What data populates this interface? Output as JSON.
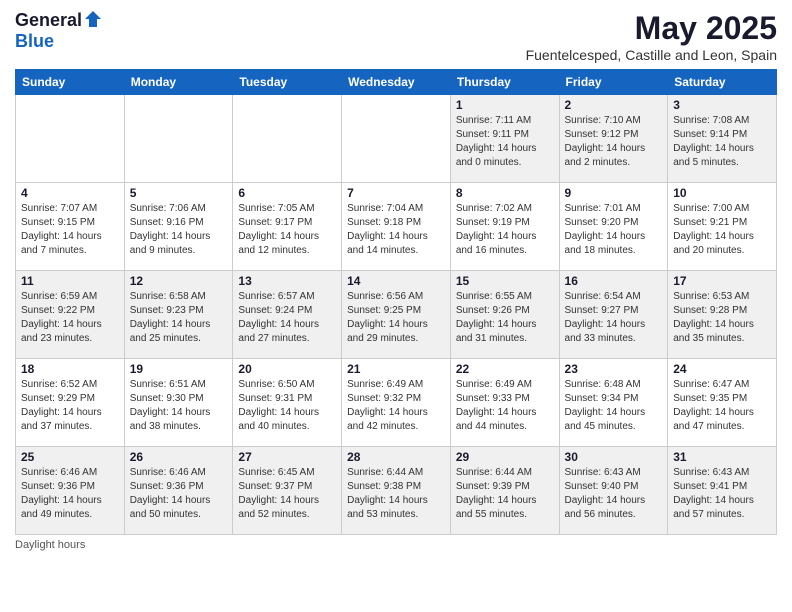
{
  "logo": {
    "general": "General",
    "blue": "Blue"
  },
  "title": "May 2025",
  "subtitle": "Fuentelcesped, Castille and Leon, Spain",
  "headers": [
    "Sunday",
    "Monday",
    "Tuesday",
    "Wednesday",
    "Thursday",
    "Friday",
    "Saturday"
  ],
  "weeks": [
    [
      {
        "day": "",
        "info": ""
      },
      {
        "day": "",
        "info": ""
      },
      {
        "day": "",
        "info": ""
      },
      {
        "day": "",
        "info": ""
      },
      {
        "day": "1",
        "info": "Sunrise: 7:11 AM\nSunset: 9:11 PM\nDaylight: 14 hours\nand 0 minutes."
      },
      {
        "day": "2",
        "info": "Sunrise: 7:10 AM\nSunset: 9:12 PM\nDaylight: 14 hours\nand 2 minutes."
      },
      {
        "day": "3",
        "info": "Sunrise: 7:08 AM\nSunset: 9:14 PM\nDaylight: 14 hours\nand 5 minutes."
      }
    ],
    [
      {
        "day": "4",
        "info": "Sunrise: 7:07 AM\nSunset: 9:15 PM\nDaylight: 14 hours\nand 7 minutes."
      },
      {
        "day": "5",
        "info": "Sunrise: 7:06 AM\nSunset: 9:16 PM\nDaylight: 14 hours\nand 9 minutes."
      },
      {
        "day": "6",
        "info": "Sunrise: 7:05 AM\nSunset: 9:17 PM\nDaylight: 14 hours\nand 12 minutes."
      },
      {
        "day": "7",
        "info": "Sunrise: 7:04 AM\nSunset: 9:18 PM\nDaylight: 14 hours\nand 14 minutes."
      },
      {
        "day": "8",
        "info": "Sunrise: 7:02 AM\nSunset: 9:19 PM\nDaylight: 14 hours\nand 16 minutes."
      },
      {
        "day": "9",
        "info": "Sunrise: 7:01 AM\nSunset: 9:20 PM\nDaylight: 14 hours\nand 18 minutes."
      },
      {
        "day": "10",
        "info": "Sunrise: 7:00 AM\nSunset: 9:21 PM\nDaylight: 14 hours\nand 20 minutes."
      }
    ],
    [
      {
        "day": "11",
        "info": "Sunrise: 6:59 AM\nSunset: 9:22 PM\nDaylight: 14 hours\nand 23 minutes."
      },
      {
        "day": "12",
        "info": "Sunrise: 6:58 AM\nSunset: 9:23 PM\nDaylight: 14 hours\nand 25 minutes."
      },
      {
        "day": "13",
        "info": "Sunrise: 6:57 AM\nSunset: 9:24 PM\nDaylight: 14 hours\nand 27 minutes."
      },
      {
        "day": "14",
        "info": "Sunrise: 6:56 AM\nSunset: 9:25 PM\nDaylight: 14 hours\nand 29 minutes."
      },
      {
        "day": "15",
        "info": "Sunrise: 6:55 AM\nSunset: 9:26 PM\nDaylight: 14 hours\nand 31 minutes."
      },
      {
        "day": "16",
        "info": "Sunrise: 6:54 AM\nSunset: 9:27 PM\nDaylight: 14 hours\nand 33 minutes."
      },
      {
        "day": "17",
        "info": "Sunrise: 6:53 AM\nSunset: 9:28 PM\nDaylight: 14 hours\nand 35 minutes."
      }
    ],
    [
      {
        "day": "18",
        "info": "Sunrise: 6:52 AM\nSunset: 9:29 PM\nDaylight: 14 hours\nand 37 minutes."
      },
      {
        "day": "19",
        "info": "Sunrise: 6:51 AM\nSunset: 9:30 PM\nDaylight: 14 hours\nand 38 minutes."
      },
      {
        "day": "20",
        "info": "Sunrise: 6:50 AM\nSunset: 9:31 PM\nDaylight: 14 hours\nand 40 minutes."
      },
      {
        "day": "21",
        "info": "Sunrise: 6:49 AM\nSunset: 9:32 PM\nDaylight: 14 hours\nand 42 minutes."
      },
      {
        "day": "22",
        "info": "Sunrise: 6:49 AM\nSunset: 9:33 PM\nDaylight: 14 hours\nand 44 minutes."
      },
      {
        "day": "23",
        "info": "Sunrise: 6:48 AM\nSunset: 9:34 PM\nDaylight: 14 hours\nand 45 minutes."
      },
      {
        "day": "24",
        "info": "Sunrise: 6:47 AM\nSunset: 9:35 PM\nDaylight: 14 hours\nand 47 minutes."
      }
    ],
    [
      {
        "day": "25",
        "info": "Sunrise: 6:46 AM\nSunset: 9:36 PM\nDaylight: 14 hours\nand 49 minutes."
      },
      {
        "day": "26",
        "info": "Sunrise: 6:46 AM\nSunset: 9:36 PM\nDaylight: 14 hours\nand 50 minutes."
      },
      {
        "day": "27",
        "info": "Sunrise: 6:45 AM\nSunset: 9:37 PM\nDaylight: 14 hours\nand 52 minutes."
      },
      {
        "day": "28",
        "info": "Sunrise: 6:44 AM\nSunset: 9:38 PM\nDaylight: 14 hours\nand 53 minutes."
      },
      {
        "day": "29",
        "info": "Sunrise: 6:44 AM\nSunset: 9:39 PM\nDaylight: 14 hours\nand 55 minutes."
      },
      {
        "day": "30",
        "info": "Sunrise: 6:43 AM\nSunset: 9:40 PM\nDaylight: 14 hours\nand 56 minutes."
      },
      {
        "day": "31",
        "info": "Sunrise: 6:43 AM\nSunset: 9:41 PM\nDaylight: 14 hours\nand 57 minutes."
      }
    ]
  ],
  "footer": "Daylight hours"
}
